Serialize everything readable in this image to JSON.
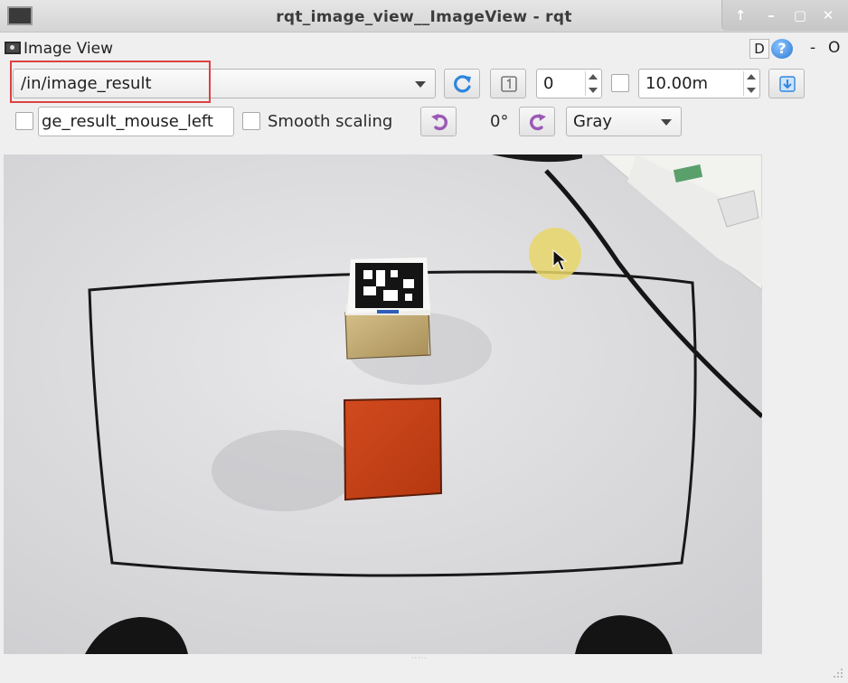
{
  "window": {
    "title": "rqt_image_view__ImageView - rqt",
    "buttons": {
      "up": "↑",
      "minimize": "–",
      "maximize": "▢",
      "close": "✕"
    }
  },
  "dock": {
    "title": "Image View",
    "d_label": "D",
    "help_label": "?",
    "minus_label": "-",
    "close_label": "O"
  },
  "toolbar": {
    "topic_value": "/in/image_result",
    "refresh_icon": "refresh-icon",
    "zoom_icon": "zoom-one-icon",
    "spin_value": "0",
    "duration_value": "10.00m",
    "save_icon": "save-icon"
  },
  "options": {
    "mouse_topic_value": "ge_result_mouse_left",
    "smooth_scaling_label": "Smooth scaling",
    "rotate_left_icon": "rotate-left-icon",
    "rotation_value": "0°",
    "rotate_right_icon": "rotate-right-icon",
    "color_scheme_value": "Gray"
  },
  "colors": {
    "accent_button_icon": "#2e86de",
    "rotate_icon": "#9b59b6",
    "highlight": "#e04040",
    "cube_red": "#c8401a",
    "cube_tan": "#c9b27c",
    "cursor_halo": "#e8d66a"
  }
}
